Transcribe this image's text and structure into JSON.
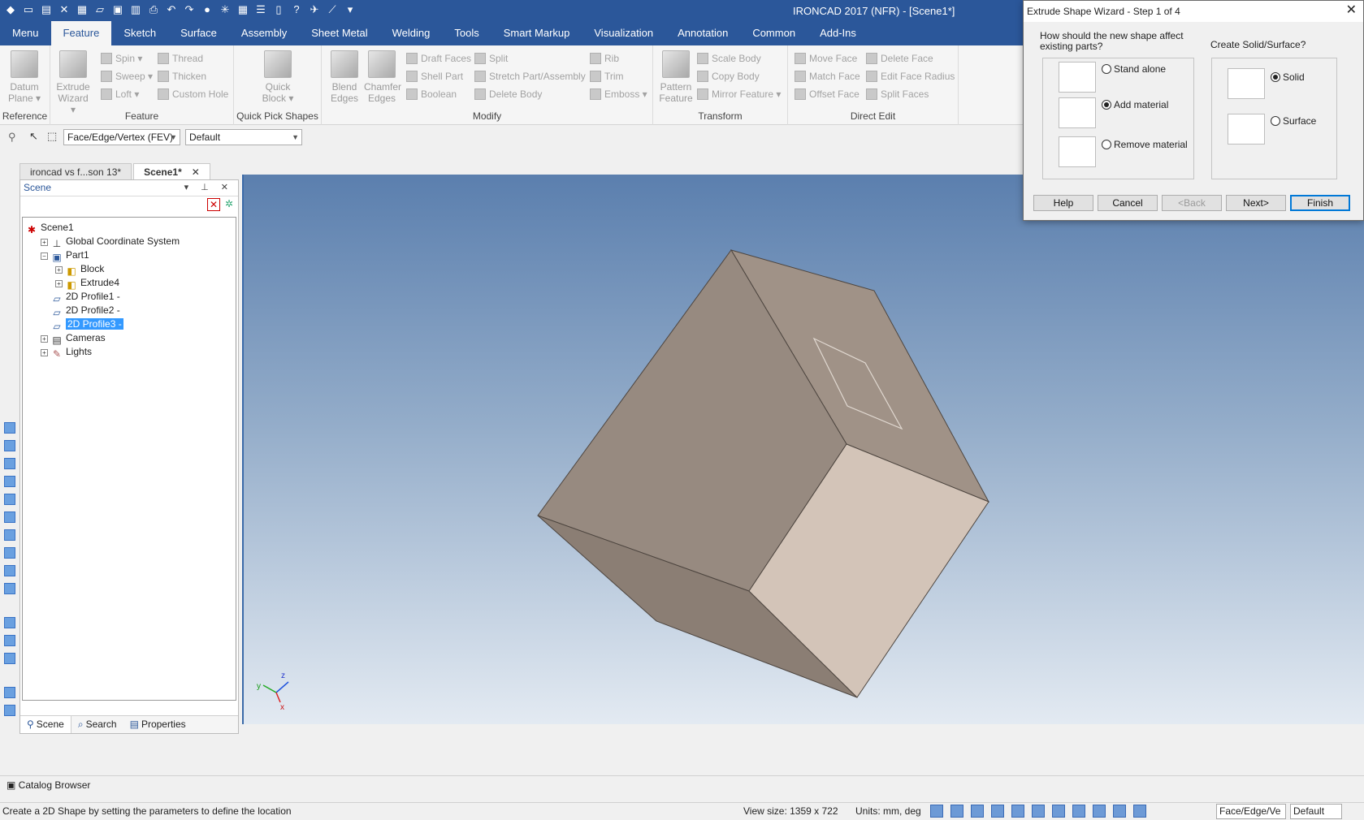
{
  "window": {
    "title": "IRONCAD 2017 (NFR) - [Scene1*]"
  },
  "menubar": [
    "Menu",
    "Feature",
    "Sketch",
    "Surface",
    "Assembly",
    "Sheet Metal",
    "Welding",
    "Tools",
    "Smart Markup",
    "Visualization",
    "Annotation",
    "Common",
    "Add-Ins"
  ],
  "ribbon": {
    "reference": {
      "label": "Reference",
      "datum_plane": "Datum\nPlane ▾"
    },
    "feature": {
      "label": "Feature",
      "extrude_wizard": "Extrude\nWizard ▾",
      "spin": "Spin ▾",
      "sweep": "Sweep ▾",
      "loft": "Loft ▾",
      "thread": "Thread",
      "thicken": "Thicken",
      "custom_hole": "Custom Hole"
    },
    "quick_pick": {
      "label": "Quick Pick Shapes",
      "quick_block": "Quick\nBlock ▾"
    },
    "modify": {
      "label": "Modify",
      "blend_edges": "Blend\nEdges",
      "chamfer_edges": "Chamfer\nEdges",
      "draft_faces": "Draft Faces",
      "shell_part": "Shell Part",
      "boolean": "Boolean",
      "split": "Split",
      "stretch": "Stretch Part/Assembly",
      "delete_body": "Delete Body",
      "rib": "Rib",
      "trim": "Trim",
      "emboss": "Emboss ▾"
    },
    "transform": {
      "label": "Transform",
      "pattern_feature": "Pattern\nFeature",
      "scale_body": "Scale Body",
      "copy_body": "Copy Body",
      "mirror_feature": "Mirror Feature ▾"
    },
    "direct_edit": {
      "label": "Direct Edit",
      "move_face": "Move Face",
      "match_face": "Match Face",
      "offset_face": "Offset Face",
      "delete_face": "Delete Face",
      "edit_face_radius": "Edit Face Radius",
      "split_faces": "Split Faces"
    }
  },
  "selection_toolbar": {
    "filter": "Face/Edge/Vertex (FEV)",
    "style": "Default"
  },
  "doc_tabs": [
    {
      "label": "ironcad vs f...son 13*",
      "active": false
    },
    {
      "label": "Scene1*",
      "active": true
    }
  ],
  "scene_panel": {
    "title": "Scene",
    "tree": [
      {
        "label": "Scene1",
        "depth": 0,
        "expander": "",
        "icon": "✱",
        "selected": false
      },
      {
        "label": "Global Coordinate System",
        "depth": 1,
        "expander": "+",
        "icon": "⊥",
        "selected": false
      },
      {
        "label": "Part1",
        "depth": 1,
        "expander": "−",
        "icon": "▣",
        "selected": false
      },
      {
        "label": "Block",
        "depth": 2,
        "expander": "+",
        "icon": "◧",
        "selected": false
      },
      {
        "label": "Extrude4",
        "depth": 2,
        "expander": "+",
        "icon": "◧",
        "selected": false
      },
      {
        "label": "2D Profile1 -",
        "depth": 1,
        "expander": "",
        "icon": "▱",
        "selected": false
      },
      {
        "label": "2D Profile2 -",
        "depth": 1,
        "expander": "",
        "icon": "▱",
        "selected": false
      },
      {
        "label": "2D Profile3 -",
        "depth": 1,
        "expander": "",
        "icon": "▱",
        "selected": true
      },
      {
        "label": "Cameras",
        "depth": 1,
        "expander": "+",
        "icon": "▤",
        "selected": false
      },
      {
        "label": "Lights",
        "depth": 1,
        "expander": "+",
        "icon": "✎",
        "selected": false
      }
    ],
    "tabs": [
      "Scene",
      "Search",
      "Properties"
    ]
  },
  "viewport": {
    "axis_labels": {
      "x": "x",
      "y": "y",
      "z": "z"
    }
  },
  "catalog_browser": "Catalog Browser",
  "status": {
    "text": "Create a 2D Shape by setting the parameters to define the location",
    "view_size": "View size: 1359 x  722",
    "units": "Units: mm, deg",
    "filter": "Face/Edge/Ve",
    "style": "Default"
  },
  "dialog": {
    "title": "Extrude Shape Wizard - Step 1 of 4",
    "question": "How should the new shape affect\nexisting parts?",
    "options": [
      {
        "label": "Stand alone",
        "checked": false
      },
      {
        "label": "Add material",
        "checked": true
      },
      {
        "label": "Remove material",
        "checked": false
      }
    ],
    "solid_surface_label": "Create Solid/Surface?",
    "solid_options": [
      {
        "label": "Solid",
        "checked": true
      },
      {
        "label": "Surface",
        "checked": false
      }
    ],
    "buttons": {
      "help": "Help",
      "cancel": "Cancel",
      "back": "<Back",
      "next": "Next>",
      "finish": "Finish"
    }
  },
  "colors": {
    "accent": "#2b579a",
    "box_face_light": "#d3c4b8",
    "box_face_mid": "#a09287",
    "box_face_dark": "#8b7e74"
  }
}
